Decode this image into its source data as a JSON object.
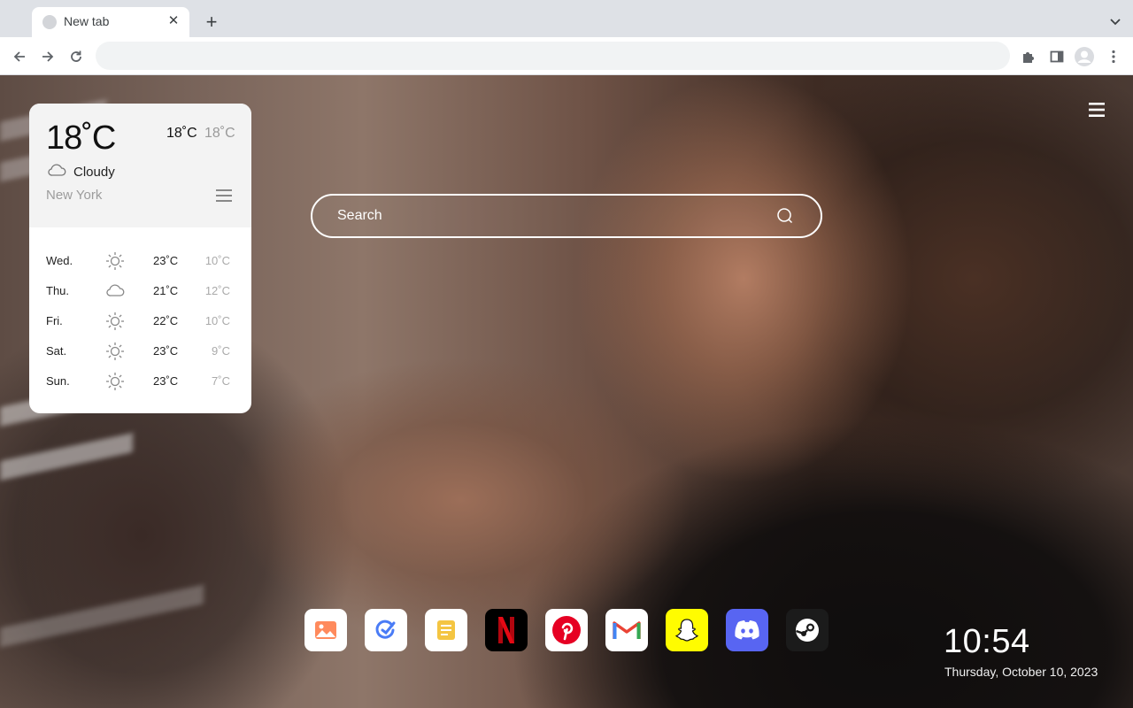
{
  "browser": {
    "tab_title": "New tab",
    "tab_close": "✕",
    "new_tab": "+",
    "omnibox_value": ""
  },
  "weather": {
    "current_temp": "18˚C",
    "high": "18˚C",
    "low": "18˚C",
    "condition": "Cloudy",
    "city": "New York",
    "forecast": [
      {
        "day": "Wed.",
        "icon": "sun-icon",
        "high": "23˚C",
        "low": "10˚C"
      },
      {
        "day": "Thu.",
        "icon": "cloud-icon",
        "high": "21˚C",
        "low": "12˚C"
      },
      {
        "day": "Fri.",
        "icon": "sun-icon",
        "high": "22˚C",
        "low": "10˚C"
      },
      {
        "day": "Sat.",
        "icon": "sun-icon",
        "high": "23˚C",
        "low": "9˚C"
      },
      {
        "day": "Sun.",
        "icon": "sun-icon",
        "high": "23˚C",
        "low": "7˚C"
      }
    ]
  },
  "search": {
    "placeholder": "Search"
  },
  "dock": [
    {
      "name": "photos-app",
      "icon": "image-icon",
      "color": "#ffffff"
    },
    {
      "name": "tasks-app",
      "icon": "check-circle-icon",
      "color": "#ffffff"
    },
    {
      "name": "notes-app",
      "icon": "note-icon",
      "color": "#ffffff"
    },
    {
      "name": "netflix-app",
      "icon": "netflix-icon",
      "color": "#000000"
    },
    {
      "name": "pinterest-app",
      "icon": "pinterest-icon",
      "color": "#ffffff"
    },
    {
      "name": "gmail-app",
      "icon": "gmail-icon",
      "color": "#ffffff"
    },
    {
      "name": "snapchat-app",
      "icon": "snapchat-icon",
      "color": "#fffc00"
    },
    {
      "name": "discord-app",
      "icon": "discord-icon",
      "color": "#5865f2"
    },
    {
      "name": "steam-app",
      "icon": "steam-icon",
      "color": "#1b1b1b"
    }
  ],
  "clock": {
    "time": "10:54",
    "date": "Thursday, October 10, 2023"
  }
}
